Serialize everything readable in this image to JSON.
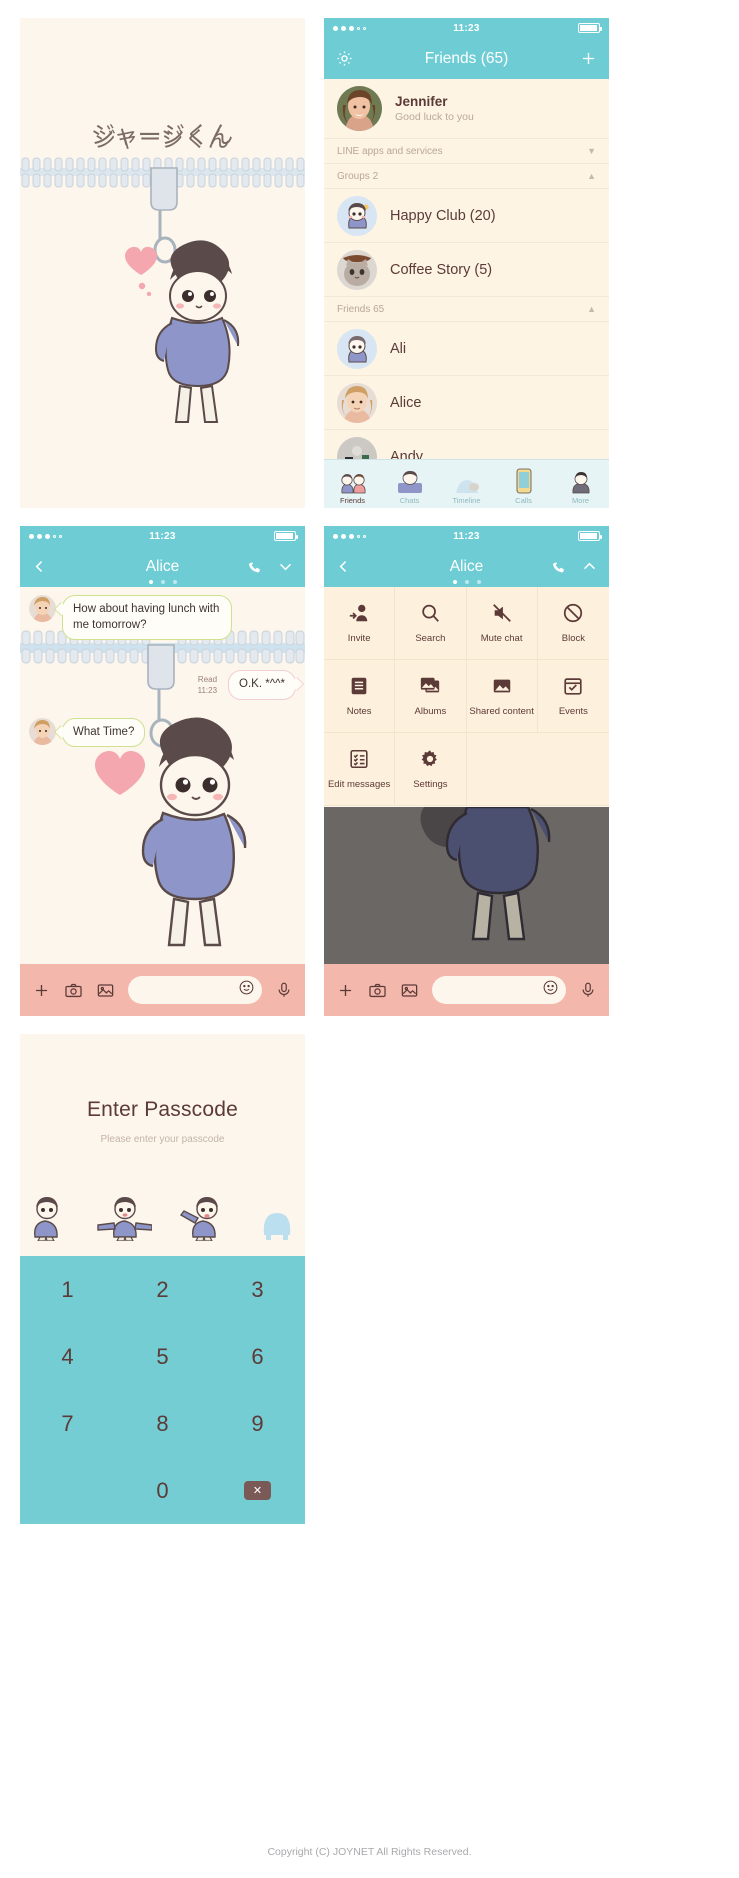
{
  "status_bar": {
    "time": "11:23",
    "signal_dots_filled": 3,
    "signal_dots_total": 5
  },
  "theme": {
    "teal": "#6ecdd4",
    "cream": "#fdf6ec",
    "list_bg": "#fdf4e4",
    "brown_text": "#5c3a38",
    "pink_bar": "#f3b7ac",
    "keypad": "#74cdd3"
  },
  "splash": {
    "title": "ジャージくん"
  },
  "friends_screen": {
    "nav": {
      "title": "Friends (65)",
      "gear_icon": "gear-icon",
      "add_icon": "plus-icon"
    },
    "profile": {
      "name": "Jennifer",
      "status": "Good luck to you"
    },
    "sections": [
      {
        "label": "LINE apps and services",
        "chevron": "chevron-down-icon",
        "items": []
      },
      {
        "label": "Groups 2",
        "chevron": "chevron-up-icon",
        "items": [
          {
            "name": "Happy Club (20)"
          },
          {
            "name": "Coffee Story (5)"
          }
        ]
      },
      {
        "label": "Friends 65",
        "chevron": "chevron-up-icon",
        "items": [
          {
            "name": "Ali"
          },
          {
            "name": "Alice"
          },
          {
            "name": "Andy"
          }
        ]
      }
    ],
    "tabs": [
      {
        "label": "Friends",
        "active": true
      },
      {
        "label": "Chats",
        "active": false
      },
      {
        "label": "Timeline",
        "active": false
      },
      {
        "label": "Calls",
        "active": false
      },
      {
        "label": "More",
        "active": false
      }
    ]
  },
  "chat_screen": {
    "nav": {
      "title": "Alice",
      "back_icon": "chevron-left-icon",
      "call_icon": "phone-icon",
      "menu_icon": "chevron-down-icon"
    },
    "messages": [
      {
        "side": "in",
        "text": "How about having lunch with me tomorrow?"
      },
      {
        "side": "out",
        "text": "O.K. *^^*",
        "read_label": "Read",
        "time": "11:23"
      },
      {
        "side": "in",
        "text": "What Time?"
      }
    ],
    "input_bar": {
      "plus_icon": "plus-icon",
      "camera_icon": "camera-icon",
      "gallery_icon": "image-icon",
      "placeholder": "",
      "value": "",
      "emoji_icon": "smiley-icon",
      "mic_icon": "microphone-icon"
    }
  },
  "menu_screen": {
    "nav": {
      "title": "Alice",
      "back_icon": "chevron-left-icon",
      "call_icon": "phone-icon",
      "menu_icon": "chevron-up-icon"
    },
    "menu_items": [
      {
        "label": "Invite",
        "icon": "invite-person-icon"
      },
      {
        "label": "Search",
        "icon": "search-icon"
      },
      {
        "label": "Mute chat",
        "icon": "mute-speaker-icon"
      },
      {
        "label": "Block",
        "icon": "block-icon"
      },
      {
        "label": "Notes",
        "icon": "notes-icon"
      },
      {
        "label": "Albums",
        "icon": "albums-icon"
      },
      {
        "label": "Shared content",
        "icon": "shared-content-icon"
      },
      {
        "label": "Events",
        "icon": "events-calendar-icon"
      },
      {
        "label": "Edit messages",
        "icon": "edit-list-icon"
      },
      {
        "label": "Settings",
        "icon": "gear-icon"
      }
    ],
    "input_bar": {
      "plus_icon": "plus-icon",
      "camera_icon": "camera-icon",
      "gallery_icon": "image-icon",
      "value": "",
      "emoji_icon": "smiley-icon",
      "mic_icon": "microphone-icon"
    }
  },
  "passcode_screen": {
    "title": "Enter Passcode",
    "subtitle": "Please enter your passcode",
    "entered_count": 3,
    "total_slots": 4,
    "keys": [
      "1",
      "2",
      "3",
      "4",
      "5",
      "6",
      "7",
      "8",
      "9",
      "",
      "0",
      "delete"
    ],
    "delete_icon": "backspace-icon"
  },
  "footer": {
    "copyright": "Copyright (C) JOYNET All Rights Reserved."
  }
}
